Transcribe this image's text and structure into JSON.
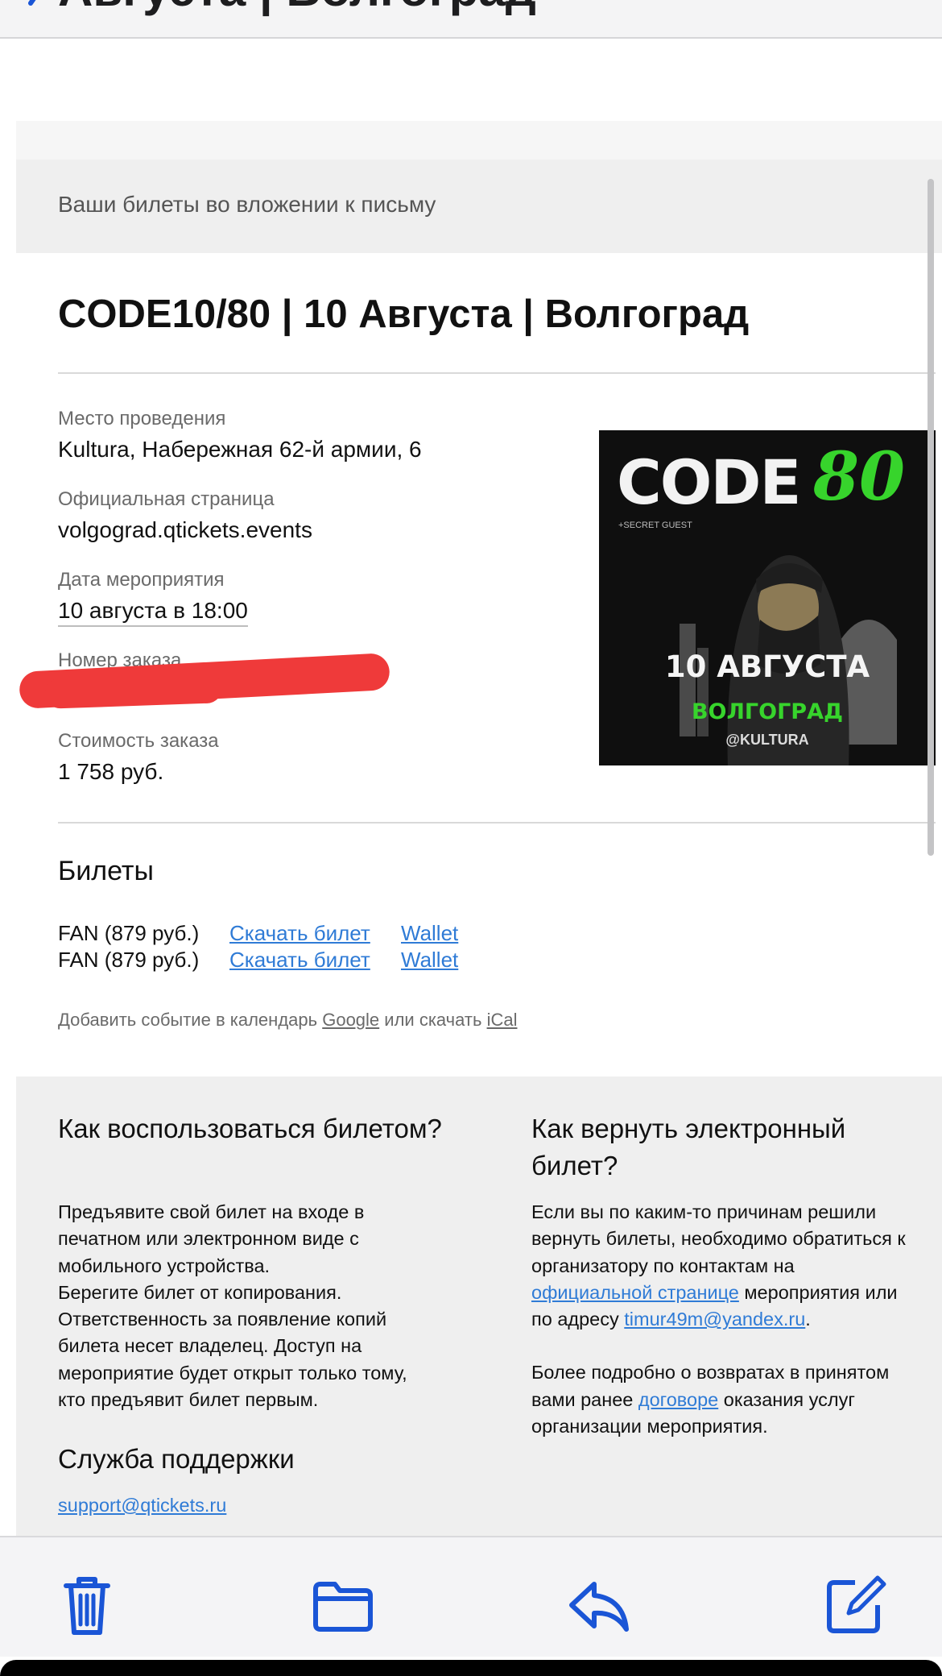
{
  "header": {
    "cut_title": "Августа | Волгоград"
  },
  "email": {
    "attachment_notice": "Ваши билеты во вложении к письму",
    "event_title": "CODE10/80 | 10 Августа | Волгоград",
    "details": {
      "venue_label": "Место проведения",
      "venue_value": "Kultura, Набережная 62-й армии, 6",
      "page_label": "Официальная страница",
      "page_value": "volgograd.qtickets.events",
      "date_label": "Дата мероприятия",
      "date_value": "10 августа в 18:00",
      "order_label": "Номер заказа",
      "cost_label": "Стоимость заказа",
      "cost_value": "1 758 руб."
    },
    "poster": {
      "code": "CODE",
      "number": "80",
      "guest": "+SECRET GUEST",
      "date": "10 АВГУСТА",
      "city": "ВОЛГОГРАД",
      "venue": "@KULTURA"
    },
    "tickets": {
      "heading": "Билеты",
      "items": [
        {
          "name": "FAN (879 руб.)",
          "download": "Скачать билет",
          "wallet": "Wallet"
        },
        {
          "name": "FAN (879 руб.)",
          "download": "Скачать билет",
          "wallet": "Wallet"
        }
      ]
    },
    "calendar": {
      "prefix": "Добавить событие в календарь",
      "google": "Google",
      "middle": "или скачать",
      "ical": "iCal"
    },
    "how_to_use": {
      "heading": "Как воспользоваться билетом?",
      "lines": [
        "Предъявите свой билет на входе в",
        "печатном или электронном виде с",
        "мобильного устройства.",
        "Берегите билет от копирования.",
        "Ответственность за появление копий",
        "билета несет владелец. Доступ на",
        "мероприятие будет открыт только тому,",
        "кто предъявит билет первым."
      ]
    },
    "support": {
      "heading": "Служба поддержки",
      "email": "support@qtickets.ru"
    },
    "refund": {
      "heading": "Как вернуть электронный билет?",
      "line1": "Если вы по каким-то причинам решили",
      "line2": "вернуть билеты, необходимо обратиться к",
      "line3": "организатору по контактам на",
      "link_page": "официальной странице",
      "after_page": " мероприятия или",
      "before_email": "по адресу ",
      "email": "timur49m@yandex.ru",
      "after_email": ".",
      "more_line1": "Более подробно о возвратах в принятом",
      "more_before_link": "вами ранее ",
      "link_contract": "договоре",
      "more_after_link": " оказания услуг",
      "more_line3": "организации мероприятия."
    }
  },
  "toolbar": {
    "icons": [
      "trash-icon",
      "folder-icon",
      "reply-icon",
      "compose-icon"
    ]
  },
  "colors": {
    "link": "#2f7bd6",
    "accent_green": "#37d42c",
    "toolbar_icon": "#1a55d6",
    "redaction": "#ef3a3a"
  }
}
